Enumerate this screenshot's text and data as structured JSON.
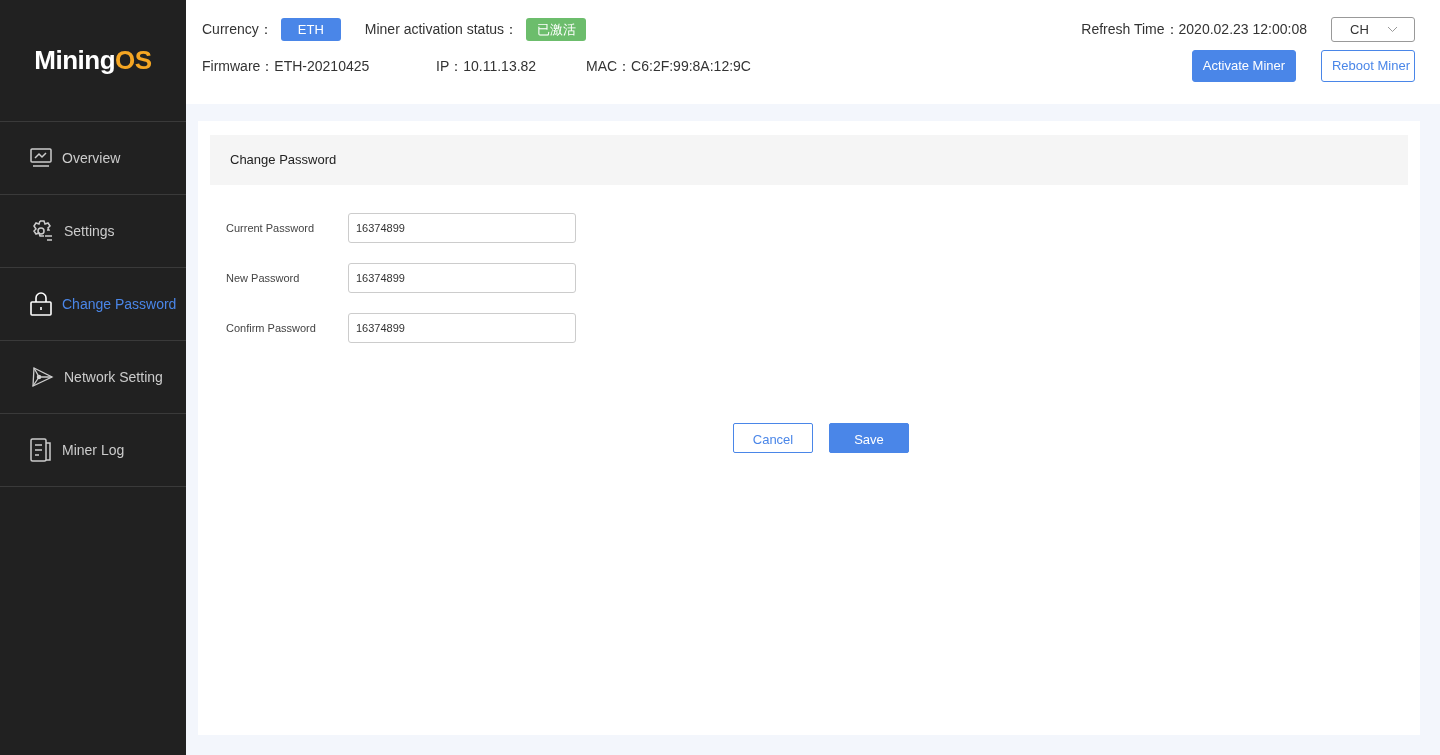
{
  "logo": {
    "main": "Mining",
    "accent": "OS"
  },
  "sidebar": {
    "items": [
      {
        "label": "Overview",
        "kind": "monitor",
        "selected": false
      },
      {
        "label": "Settings",
        "kind": "gear",
        "selected": false
      },
      {
        "label": "Change Password",
        "kind": "lock",
        "selected": true
      },
      {
        "label": "Network Setting",
        "kind": "network",
        "selected": false
      },
      {
        "label": "Miner Log",
        "kind": "document",
        "selected": false
      }
    ]
  },
  "header": {
    "currency": {
      "label": "Currency：",
      "value": "ETH"
    },
    "activation": {
      "label": "Miner activation status：",
      "value": "已激活"
    },
    "refresh": {
      "label": "Refresh Time：",
      "value": "2020.02.23 12:00:08"
    },
    "language": {
      "value": "CH"
    },
    "firmware": {
      "label": "Firmware：",
      "value": "ETH-20210425"
    },
    "ip": {
      "label": "IP：",
      "value": "10.11.13.82"
    },
    "mac": {
      "label": "MAC：",
      "value": "C6:2F:99:8A:12:9C"
    },
    "buttons": [
      {
        "label": "Activate Miner",
        "kind": "primary"
      },
      {
        "label": "Reboot Miner",
        "kind": "outline"
      }
    ]
  },
  "form": {
    "title": "Change Password",
    "fields": [
      {
        "label": "Current Password",
        "value": "16374899"
      },
      {
        "label": "New Password",
        "value": "16374899"
      },
      {
        "label": "Confirm Password",
        "value": "16374899"
      }
    ],
    "buttons": [
      {
        "label": "Cancel",
        "kind": "outline"
      },
      {
        "label": "Save",
        "kind": "primary"
      }
    ]
  }
}
